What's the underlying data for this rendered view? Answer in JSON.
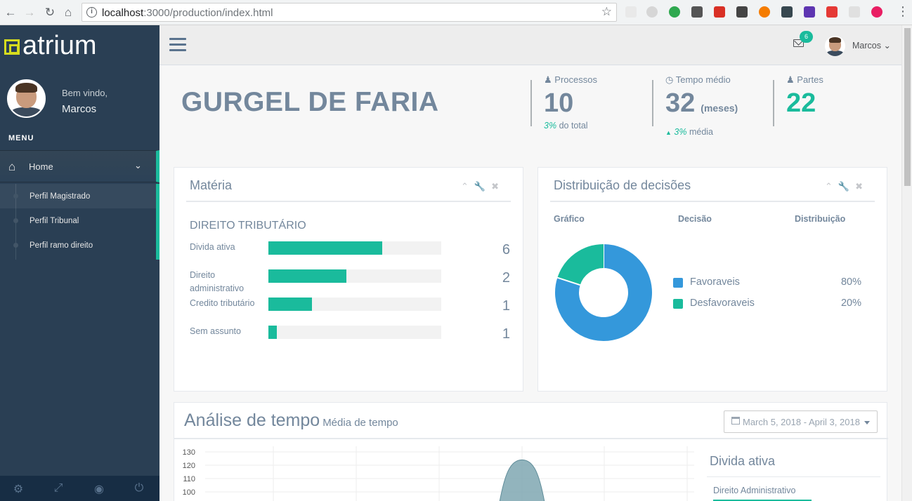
{
  "browser": {
    "url_host": "localhost",
    "url_path": ":3000/production/index.html"
  },
  "sidebar": {
    "logo_text": "atrium",
    "welcome": "Bem vindo,",
    "user_name": "Marcos",
    "menu_label": "MENU",
    "nav_home": "Home",
    "sub_items": [
      {
        "label": "Perfil Magistrado"
      },
      {
        "label": "Perfil Tribunal"
      },
      {
        "label": "Perfil ramo direito"
      }
    ]
  },
  "topnav": {
    "mail_count": "6",
    "user_name": "Marcos"
  },
  "header": {
    "judge_name": "GURGEL DE FARIA",
    "stats": {
      "processos": {
        "caption": "Processos",
        "value": "10",
        "pct": "3%",
        "note": "do total"
      },
      "tempo": {
        "caption": "Tempo médio",
        "value": "32",
        "unit": "(meses)",
        "pct": "3%",
        "note": "média"
      },
      "partes": {
        "caption": "Partes",
        "value": "22"
      }
    }
  },
  "materia": {
    "title": "Matéria",
    "heading": "DIREITO TRIBUTÁRIO",
    "rows": [
      {
        "label": "Divida ativa",
        "value": "6",
        "fill": 0.66
      },
      {
        "label": "Direito administrativo",
        "value": "2",
        "fill": 0.45
      },
      {
        "label": "Credito tributário",
        "value": "1",
        "fill": 0.25
      },
      {
        "label": "Sem assunto",
        "value": "1",
        "fill": 0.05
      }
    ]
  },
  "decisoes": {
    "title": "Distribuição de decisões",
    "col_grafico": "Gráfico",
    "col_decisao": "Decisão",
    "col_distribuicao": "Distribuição",
    "items": [
      {
        "name": "Favoraveis",
        "pct": "80%",
        "color": "#3498DB"
      },
      {
        "name": "Desfavoraveis",
        "pct": "20%",
        "color": "#1ABB9C"
      }
    ]
  },
  "tempo": {
    "title": "Análise de tempo",
    "subtitle": "Média de tempo",
    "date_range": "March 5, 2018 - April 3, 2018",
    "side_title": "Divida ativa",
    "side_item": "Direito Administrativo"
  },
  "chart_data": {
    "type": "area",
    "y_ticks": [
      "130",
      "120",
      "110",
      "100"
    ],
    "ylim": [
      100,
      130
    ],
    "peak_value": 124,
    "color": "#7FA7B2",
    "grid": true
  },
  "colors": {
    "sidebar": "#2A3F54",
    "accent": "#1ABB9C",
    "blue": "#3498DB",
    "text": "#73879C"
  }
}
